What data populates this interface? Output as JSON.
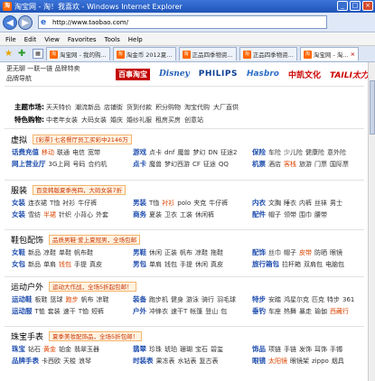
{
  "window": {
    "title": "淘宝网 - 淘！我喜欢 - Windows Internet Explorer",
    "min_glyph": "_",
    "max_glyph": "□",
    "close_glyph": "×"
  },
  "addressbar": {
    "back_glyph": "◀",
    "fwd_glyph": "▶",
    "url": "http://www.taobao.com/"
  },
  "menu": {
    "items": [
      "File",
      "Edit",
      "View",
      "Favorites",
      "Tools",
      "Help"
    ]
  },
  "tabs": [
    {
      "label": "淘宝网 - 我的购...",
      "active": false
    },
    {
      "label": "淘金币 2012夏...",
      "active": false
    },
    {
      "label": "正品四季物资...",
      "active": false
    },
    {
      "label": "正品四季物资...",
      "active": false
    },
    {
      "label": "淘宝网 - 淘...",
      "active": true
    }
  ],
  "page": {
    "topstrip": {
      "line1": "更无聊 一联一链   品牌特卖",
      "line2": "品牌导航"
    },
    "brands": [
      "百事淘宝",
      "Disney",
      "PHILIPS",
      "Hasbro",
      "中凯文化",
      "TAILI太力"
    ],
    "markets": {
      "label": "主题市场:",
      "items": [
        "天天特价",
        "潮流新品",
        "店铺街",
        "货到付款",
        "积分购物",
        "淘宝代购",
        "大厂直供"
      ]
    },
    "special": {
      "label": "特色购物:",
      "items": [
        "中老年女装",
        "大码女装",
        "婚庆",
        "婚纱礼服",
        "租房买房",
        "创意站"
      ]
    },
    "categories": [
      {
        "title": "虚拟",
        "promo": "[彩票] 七名餐厅员工买彩中2146万",
        "rows": [
          {
            "groups": [
              {
                "head": "话费充值",
                "items": [
                  {
                    "t": "移动",
                    "red": true
                  },
                  {
                    "t": "联通"
                  },
                  {
                    "t": "电信"
                  },
                  {
                    "t": "宽带"
                  }
                ]
              },
              {
                "head": "游戏",
                "items": [
                  {
                    "t": "点卡"
                  },
                  {
                    "t": "dnf"
                  },
                  {
                    "t": "魔兽"
                  },
                  {
                    "t": "梦幻"
                  },
                  {
                    "t": "DN"
                  },
                  {
                    "t": "征途2"
                  }
                ]
              },
              {
                "head": "保险",
                "items": [
                  {
                    "t": "车险"
                  },
                  {
                    "t": "少儿险"
                  },
                  {
                    "t": "健康险"
                  },
                  {
                    "t": "意外险"
                  }
                ]
              }
            ]
          },
          {
            "groups": [
              {
                "head": "网上营业厅",
                "items": [
                  {
                    "t": "3G上网"
                  },
                  {
                    "t": "号码"
                  },
                  {
                    "t": "合约机"
                  }
                ]
              },
              {
                "head": "点卡",
                "items": [
                  {
                    "t": "魔兽"
                  },
                  {
                    "t": "梦幻西游"
                  },
                  {
                    "t": "CF"
                  },
                  {
                    "t": "征途"
                  },
                  {
                    "t": "QQ"
                  }
                ]
              },
              {
                "head": "机票",
                "items": [
                  {
                    "t": "酒店"
                  },
                  {
                    "t": "客栈",
                    "red": true
                  },
                  {
                    "t": "旅游"
                  },
                  {
                    "t": "门票"
                  },
                  {
                    "t": "国际票"
                  }
                ]
              }
            ]
          }
        ]
      },
      {
        "title": "服装",
        "promo": "百变韩版夏季亮四，大码女装7折",
        "rows": [
          {
            "groups": [
              {
                "head": "女装",
                "items": [
                  {
                    "t": "连衣裙"
                  },
                  {
                    "t": "T恤"
                  },
                  {
                    "t": "衬衫"
                  },
                  {
                    "t": "牛仔裤"
                  }
                ]
              },
              {
                "head": "男装",
                "items": [
                  {
                    "t": "T恤"
                  },
                  {
                    "t": "衬衫",
                    "red": true
                  },
                  {
                    "t": "polo"
                  },
                  {
                    "t": "夹克"
                  },
                  {
                    "t": "牛仔裤"
                  }
                ]
              },
              {
                "head": "内衣",
                "items": [
                  {
                    "t": "文胸"
                  },
                  {
                    "t": "睡衣"
                  },
                  {
                    "t": "内裤"
                  },
                  {
                    "t": "丝袜"
                  },
                  {
                    "t": "男士"
                  }
                ]
              }
            ]
          },
          {
            "groups": [
              {
                "head": "女装",
                "items": [
                  {
                    "t": "雪纺"
                  },
                  {
                    "t": "半裙",
                    "red": true
                  },
                  {
                    "t": "针织"
                  },
                  {
                    "t": "小背心"
                  },
                  {
                    "t": "外套"
                  }
                ]
              },
              {
                "head": "商务",
                "items": [
                  {
                    "t": "夏装"
                  },
                  {
                    "t": "卫衣"
                  },
                  {
                    "t": "工装"
                  },
                  {
                    "t": "休闲裤"
                  }
                ]
              },
              {
                "head": "配件",
                "items": [
                  {
                    "t": "帽子"
                  },
                  {
                    "t": "领带"
                  },
                  {
                    "t": "围巾"
                  },
                  {
                    "t": "腰带"
                  }
                ]
              }
            ]
          }
        ]
      },
      {
        "title": "鞋包配饰",
        "promo": "品质男鞋·爱上夏冠男，全场包邮",
        "rows": [
          {
            "groups": [
              {
                "head": "女鞋",
                "items": [
                  {
                    "t": "新品"
                  },
                  {
                    "t": "凉鞋"
                  },
                  {
                    "t": "单鞋"
                  },
                  {
                    "t": "帆布鞋"
                  }
                ]
              },
              {
                "head": "男鞋",
                "items": [
                  {
                    "t": "休闲"
                  },
                  {
                    "t": "正装"
                  },
                  {
                    "t": "帆布"
                  },
                  {
                    "t": "凉鞋"
                  },
                  {
                    "t": "拖鞋"
                  }
                ]
              },
              {
                "head": "配饰",
                "items": [
                  {
                    "t": "丝巾"
                  },
                  {
                    "t": "帽子"
                  },
                  {
                    "t": "皮带",
                    "red": true
                  },
                  {
                    "t": "防晒"
                  },
                  {
                    "t": "眼镜"
                  }
                ]
              }
            ]
          },
          {
            "groups": [
              {
                "head": "女包",
                "items": [
                  {
                    "t": "新品"
                  },
                  {
                    "t": "单肩"
                  },
                  {
                    "t": "钱包",
                    "red": true
                  },
                  {
                    "t": "手提"
                  },
                  {
                    "t": "真皮"
                  }
                ]
              },
              {
                "head": "男包",
                "items": [
                  {
                    "t": "单肩"
                  },
                  {
                    "t": "钱包"
                  },
                  {
                    "t": "手提"
                  },
                  {
                    "t": "休闲"
                  },
                  {
                    "t": "真皮"
                  }
                ]
              },
              {
                "head": "旅行箱包",
                "items": [
                  {
                    "t": "拉杆箱"
                  },
                  {
                    "t": "双肩包"
                  },
                  {
                    "t": "电脑包"
                  }
                ]
              }
            ]
          }
        ]
      },
      {
        "title": "运动户外",
        "promo": "运动大作战，全场5折起包邮！",
        "rows": [
          {
            "groups": [
              {
                "head": "运动鞋",
                "items": [
                  {
                    "t": "板鞋"
                  },
                  {
                    "t": "篮球"
                  },
                  {
                    "t": "跑步",
                    "red": true
                  },
                  {
                    "t": "帆布"
                  },
                  {
                    "t": "凉鞋"
                  }
                ]
              },
              {
                "head": "装备",
                "items": [
                  {
                    "t": "跑步机"
                  },
                  {
                    "t": "健身"
                  },
                  {
                    "t": "游泳"
                  },
                  {
                    "t": "骑行"
                  },
                  {
                    "t": "羽毛球"
                  }
                ]
              },
              {
                "head": "特步",
                "items": [
                  {
                    "t": "安踏"
                  },
                  {
                    "t": "鸿星尔克"
                  },
                  {
                    "t": "匹克"
                  },
                  {
                    "t": "特步"
                  },
                  {
                    "t": "361"
                  }
                ]
              }
            ]
          },
          {
            "groups": [
              {
                "head": "运动服",
                "items": [
                  {
                    "t": "T恤"
                  },
                  {
                    "t": "套装"
                  },
                  {
                    "t": "速干"
                  },
                  {
                    "t": "T恤"
                  },
                  {
                    "t": "短裤"
                  }
                ]
              },
              {
                "head": "户外",
                "items": [
                  {
                    "t": "冲锋衣"
                  },
                  {
                    "t": "速干T"
                  },
                  {
                    "t": "帐篷"
                  },
                  {
                    "t": "登山"
                  },
                  {
                    "t": "包"
                  }
                ]
              },
              {
                "head": "垂钓",
                "items": [
                  {
                    "t": "车座"
                  },
                  {
                    "t": "热舞"
                  },
                  {
                    "t": "暴走"
                  },
                  {
                    "t": "瑜伽"
                  },
                  {
                    "t": "西藏行",
                    "red": true
                  }
                ]
              }
            ]
          }
        ]
      },
      {
        "title": "珠宝手表",
        "promo": "夏季美妆配饰品，全场5折包邮！",
        "rows": [
          {
            "groups": [
              {
                "head": "珠宝",
                "items": [
                  {
                    "t": "钻石"
                  },
                  {
                    "t": "黄金",
                    "red": true
                  },
                  {
                    "t": "铂金"
                  },
                  {
                    "t": "翡翠玉器"
                  }
                ]
              },
              {
                "head": "翡翠",
                "items": [
                  {
                    "t": "珍珠"
                  },
                  {
                    "t": "琥珀"
                  },
                  {
                    "t": "珊瑚"
                  },
                  {
                    "t": "宝石"
                  },
                  {
                    "t": "碧玺"
                  }
                ]
              },
              {
                "head": "饰品",
                "items": [
                  {
                    "t": "项链"
                  },
                  {
                    "t": "手链"
                  },
                  {
                    "t": "发饰"
                  },
                  {
                    "t": "耳饰"
                  },
                  {
                    "t": "手镯"
                  }
                ]
              }
            ]
          },
          {
            "groups": [
              {
                "head": "品牌手表",
                "items": [
                  {
                    "t": "卡西欧"
                  },
                  {
                    "t": "天梭"
                  },
                  {
                    "t": "浪琴"
                  }
                ]
              },
              {
                "head": "时装表",
                "items": [
                  {
                    "t": "果冻表"
                  },
                  {
                    "t": "水钻表"
                  },
                  {
                    "t": "复古表"
                  }
                ]
              },
              {
                "head": "眼镜",
                "items": [
                  {
                    "t": "太阳镜",
                    "red": true
                  },
                  {
                    "t": "眼镜架"
                  },
                  {
                    "t": "zippo"
                  },
                  {
                    "t": "烟具"
                  }
                ]
              }
            ]
          }
        ]
      }
    ]
  }
}
